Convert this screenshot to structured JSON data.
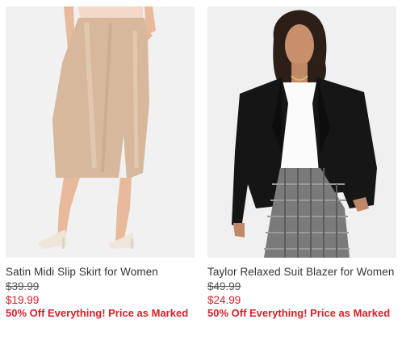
{
  "products": [
    {
      "name": "Satin Midi Slip Skirt for Women",
      "original_price": "$39.99",
      "sale_price": "$19.99",
      "promo": "50% Off Everything! Price as Marked"
    },
    {
      "name": "Taylor Relaxed Suit Blazer for Women",
      "original_price": "$49.99",
      "sale_price": "$24.99",
      "promo": "50% Off Everything! Price as Marked"
    }
  ],
  "colors": {
    "sale": "#d3222a",
    "text": "#333333",
    "image_bg": "#f2f2f2"
  }
}
